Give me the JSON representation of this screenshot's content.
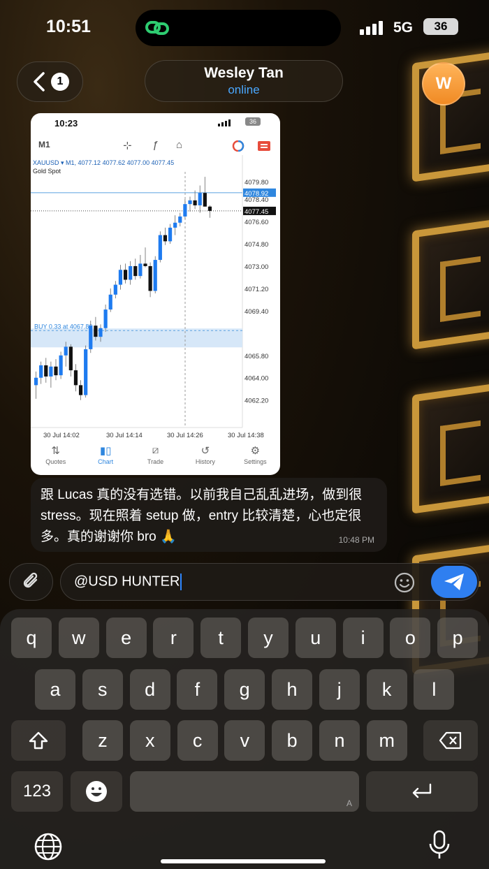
{
  "status_bar": {
    "time": "10:51",
    "network": "5G",
    "battery": "36"
  },
  "header": {
    "back_count": "1",
    "name": "Wesley Tan",
    "status": "online",
    "avatar_letter": "W"
  },
  "screenshot": {
    "time": "10:23",
    "battery": "36",
    "timeframe": "M1",
    "symbol_line": "XAUUSD ▾ M1, 4077.12 4077.62 4077.00 4077.45",
    "symbol_desc": "Gold Spot",
    "buy_label": "BUY 0.33 at 4067.80",
    "bid_label": "4078.92",
    "last_label": "4077.45",
    "tabs": [
      {
        "label": "Quotes",
        "icon": "quotes-icon"
      },
      {
        "label": "Chart",
        "icon": "chart-icon"
      },
      {
        "label": "Trade",
        "icon": "trade-icon"
      },
      {
        "label": "History",
        "icon": "history-icon"
      },
      {
        "label": "Settings",
        "icon": "settings-icon"
      }
    ]
  },
  "chart_data": {
    "type": "candlestick",
    "title": "XAUUSD M1 Gold Spot",
    "x_ticks": [
      "30 Jul 14:02",
      "30 Jul 14:14",
      "30 Jul 14:26",
      "30 Jul 14:38"
    ],
    "y_ticks": [
      "4079.80",
      "4078.40",
      "4076.60",
      "4074.80",
      "4073.00",
      "4071.20",
      "4069.40",
      "4065.80",
      "4064.00",
      "4062.20"
    ],
    "ylim": [
      4061.0,
      4080.6
    ],
    "candles": [
      [
        4063.4,
        4064.5,
        4062.3,
        4064.0
      ],
      [
        4064.0,
        4065.3,
        4063.5,
        4065.0
      ],
      [
        4065.0,
        4065.6,
        4063.6,
        4064.1
      ],
      [
        4064.1,
        4065.3,
        4063.2,
        4064.9
      ],
      [
        4064.9,
        4065.5,
        4063.8,
        4064.2
      ],
      [
        4064.2,
        4066.1,
        4063.9,
        4065.8
      ],
      [
        4065.8,
        4066.9,
        4064.9,
        4066.5
      ],
      [
        4066.5,
        4066.7,
        4064.1,
        4064.6
      ],
      [
        4064.6,
        4065.1,
        4062.9,
        4063.4
      ],
      [
        4063.4,
        4063.8,
        4062.2,
        4062.6
      ],
      [
        4062.6,
        4066.6,
        4062.4,
        4066.3
      ],
      [
        4066.3,
        4068.6,
        4066.0,
        4068.2
      ],
      [
        4068.2,
        4068.9,
        4067.0,
        4067.3
      ],
      [
        4067.3,
        4068.3,
        4066.9,
        4068.0
      ],
      [
        4068.0,
        4069.9,
        4067.7,
        4069.5
      ],
      [
        4069.5,
        4071.2,
        4069.3,
        4070.7
      ],
      [
        4070.7,
        4071.8,
        4070.4,
        4071.5
      ],
      [
        4071.5,
        4073.1,
        4071.1,
        4072.7
      ],
      [
        4072.7,
        4073.2,
        4071.6,
        4071.9
      ],
      [
        4071.9,
        4073.4,
        4071.5,
        4073.0
      ],
      [
        4073.0,
        4073.6,
        4071.9,
        4072.2
      ],
      [
        4072.2,
        4073.9,
        4072.0,
        4073.2
      ],
      [
        4073.2,
        4074.5,
        4072.9,
        4073.0
      ],
      [
        4073.0,
        4073.3,
        4070.5,
        4071.0
      ],
      [
        4071.0,
        4073.8,
        4070.8,
        4073.5
      ],
      [
        4073.5,
        4075.8,
        4073.3,
        4075.5
      ],
      [
        4075.5,
        4076.1,
        4074.7,
        4075.0
      ],
      [
        4075.0,
        4076.4,
        4074.8,
        4076.1
      ],
      [
        4076.1,
        4077.1,
        4075.5,
        4076.5
      ],
      [
        4076.5,
        4077.3,
        4076.2,
        4077.0
      ],
      [
        4077.0,
        4078.4,
        4076.8,
        4078.0
      ],
      [
        4078.0,
        4078.6,
        4077.4,
        4078.3
      ],
      [
        4078.3,
        4079.1,
        4077.6,
        4077.9
      ],
      [
        4077.9,
        4079.5,
        4077.3,
        4078.9
      ],
      [
        4078.9,
        4080.2,
        4077.8,
        4077.8
      ],
      [
        4077.8,
        4077.9,
        4076.9,
        4077.45
      ]
    ],
    "bid_line": 4078.92,
    "buy_price": 4067.8,
    "grid": false
  },
  "message": {
    "text": "跟 Lucas 真的没有选错。以前我自己乱乱进场，做到很 stress。现在照着 setup 做，entry 比较清楚，心也定很多。真的谢谢你 bro 🙏",
    "time": "10:48 PM"
  },
  "composer": {
    "value": "@USD HUNTER"
  },
  "keyboard": {
    "row1": [
      "q",
      "w",
      "e",
      "r",
      "t",
      "y",
      "u",
      "i",
      "o",
      "p"
    ],
    "row2": [
      "a",
      "s",
      "d",
      "f",
      "g",
      "h",
      "j",
      "k",
      "l"
    ],
    "row3": [
      "z",
      "x",
      "c",
      "v",
      "b",
      "n",
      "m"
    ],
    "numbers_label": "123",
    "space_hint": "A"
  }
}
